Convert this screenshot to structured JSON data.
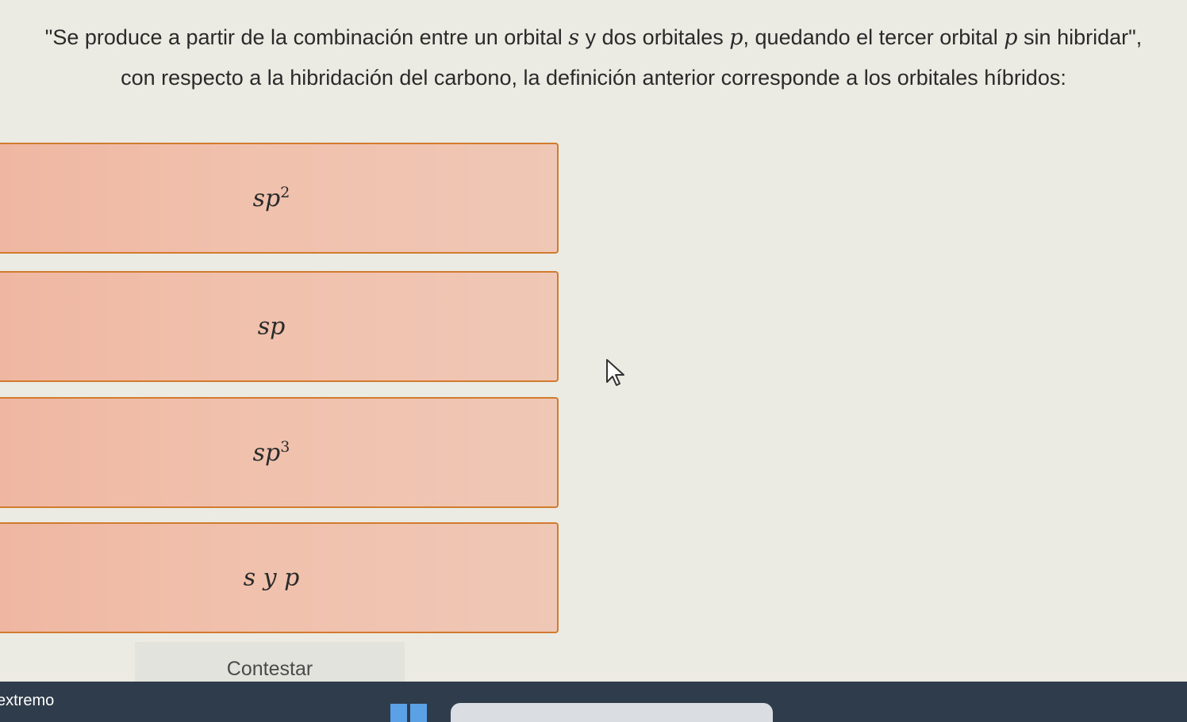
{
  "question": {
    "line1_part1": "\"Se produce a partir de la combinación entre un orbital ",
    "var_s": "s",
    "line1_part2": " y dos orbitales ",
    "var_p1": "p",
    "line1_part3": ", quedando el tercer orbital ",
    "var_p2": "p",
    "line1_part4": " sin hibridar\",",
    "line2": "con respecto a la hibridación del carbono, la definición anterior corresponde a los orbitales híbridos:"
  },
  "options": [
    {
      "base": "sp",
      "sup": "2"
    },
    {
      "base": "sp",
      "sup": ""
    },
    {
      "base": "sp",
      "sup": "3"
    },
    {
      "base": "s y p",
      "sup": ""
    }
  ],
  "submit_label": "Contestar",
  "taskbar": {
    "label": "extremo"
  },
  "colors": {
    "option_border": "#d27a2e",
    "option_fill": "#f0c1ad",
    "taskbar": "#2e3c4c"
  }
}
